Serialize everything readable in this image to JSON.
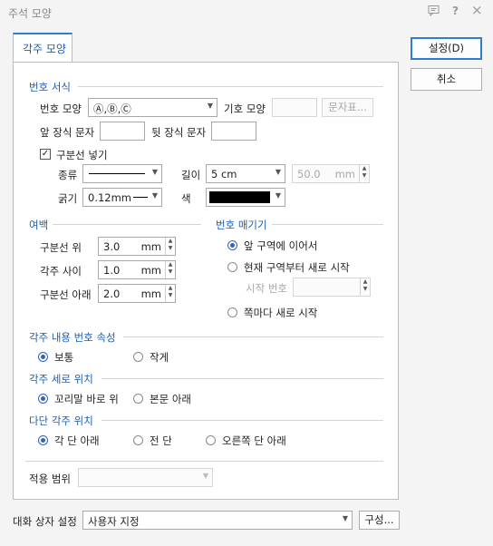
{
  "window": {
    "title": "주석 모양",
    "icons": [
      "comment-icon",
      "help-icon",
      "close-icon"
    ],
    "help_glyph": "?",
    "close_glyph": "×"
  },
  "tab": {
    "label": "각주 모양"
  },
  "buttons": {
    "ok": "설정(D)",
    "cancel": "취소",
    "compose": "구성..."
  },
  "numbering": {
    "section_title": "번호 서식",
    "number_shape_label": "번호 모양",
    "number_shape_value": "Ⓐ,Ⓑ,Ⓒ",
    "symbol_shape_label": "기호 모양",
    "symbol_shape_value": "",
    "char_table_button": "문자표...",
    "prefix_label": "앞 장식 문자",
    "prefix_value": "",
    "suffix_label": "뒷 장식 문자",
    "suffix_value": "",
    "separator_checkbox": "구분선 넣기",
    "separator_checked": true,
    "type_label": "종류",
    "length_label": "길이",
    "length_value": "5 cm",
    "length_custom_value": "50.0",
    "length_custom_unit": "mm",
    "thickness_label": "굵기",
    "thickness_value": "0.12mm",
    "color_label": "색",
    "color_value": "#000000"
  },
  "margin": {
    "section_title": "여백",
    "rows": [
      {
        "label": "구분선 위",
        "value": "3.0",
        "unit": "mm"
      },
      {
        "label": "각주 사이",
        "value": "1.0",
        "unit": "mm"
      },
      {
        "label": "구분선 아래",
        "value": "2.0",
        "unit": "mm"
      }
    ]
  },
  "restart": {
    "section_title": "번호 매기기",
    "continue_label": "앞 구역에 이어서",
    "new_section_label": "현재 구역부터 새로 시작",
    "start_number_label": "시작 번호",
    "start_number_value": "",
    "per_page_label": "쪽마다 새로 시작",
    "selected": "continue"
  },
  "attr": {
    "section_title": "각주 내용 번호 속성",
    "normal_label": "보통",
    "small_label": "작게",
    "selected": "normal"
  },
  "vertical": {
    "section_title": "각주 세로 위치",
    "below_text_label": "꼬리말 바로 위",
    "below_body_label": "본문 아래",
    "selected": "below_text"
  },
  "multicol": {
    "section_title": "다단 각주 위치",
    "each_label": "각 단 아래",
    "all_label": "전 단",
    "right_label": "오른쪽 단 아래",
    "selected": "each"
  },
  "scope": {
    "label": "적용 범위",
    "value": ""
  },
  "dialog_setting": {
    "label": "대화 상자 설정",
    "value": "사용자 지정"
  }
}
